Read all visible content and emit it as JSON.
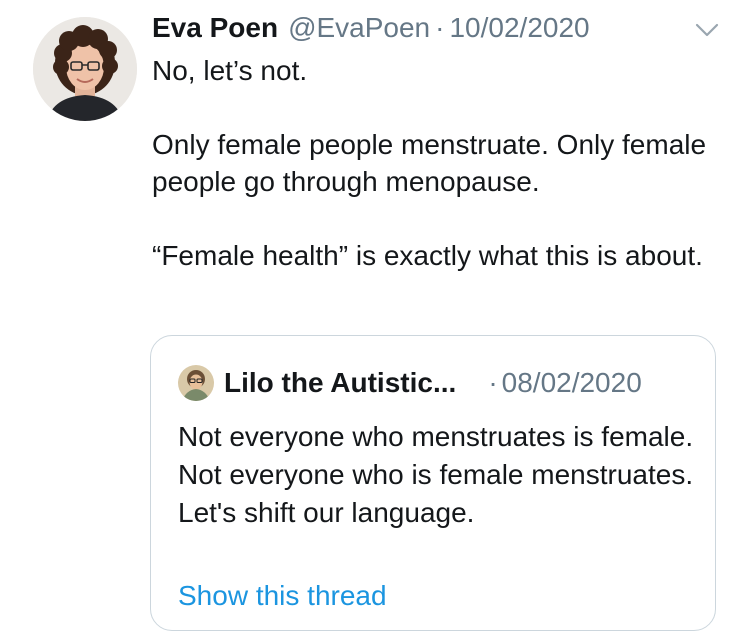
{
  "tweet": {
    "author": {
      "display_name": "Eva Poen",
      "handle": "@EvaPoen",
      "avatar_icon": "profile-photo"
    },
    "separator": "·",
    "date": "10/02/2020",
    "body": {
      "paragraph_1": "No, let’s not.",
      "paragraph_2": "Only female people menstruate. Only female people go through menopause.",
      "paragraph_3": "“Female health” is exactly what this is about."
    },
    "menu_icon": "chevron-down-icon"
  },
  "quoted_tweet": {
    "author": {
      "display_name": "Lilo the Autistic...",
      "avatar_icon": "profile-photo"
    },
    "separator": "·",
    "date": "08/02/2020",
    "body": "Not everyone who menstruates is female. Not everyone who is female menstruates. Let's shift our language.",
    "show_thread_label": "Show this thread"
  },
  "colors": {
    "text_primary": "#14171a",
    "text_secondary": "#657786",
    "link": "#1b95e0",
    "border": "#ccd6dd"
  }
}
